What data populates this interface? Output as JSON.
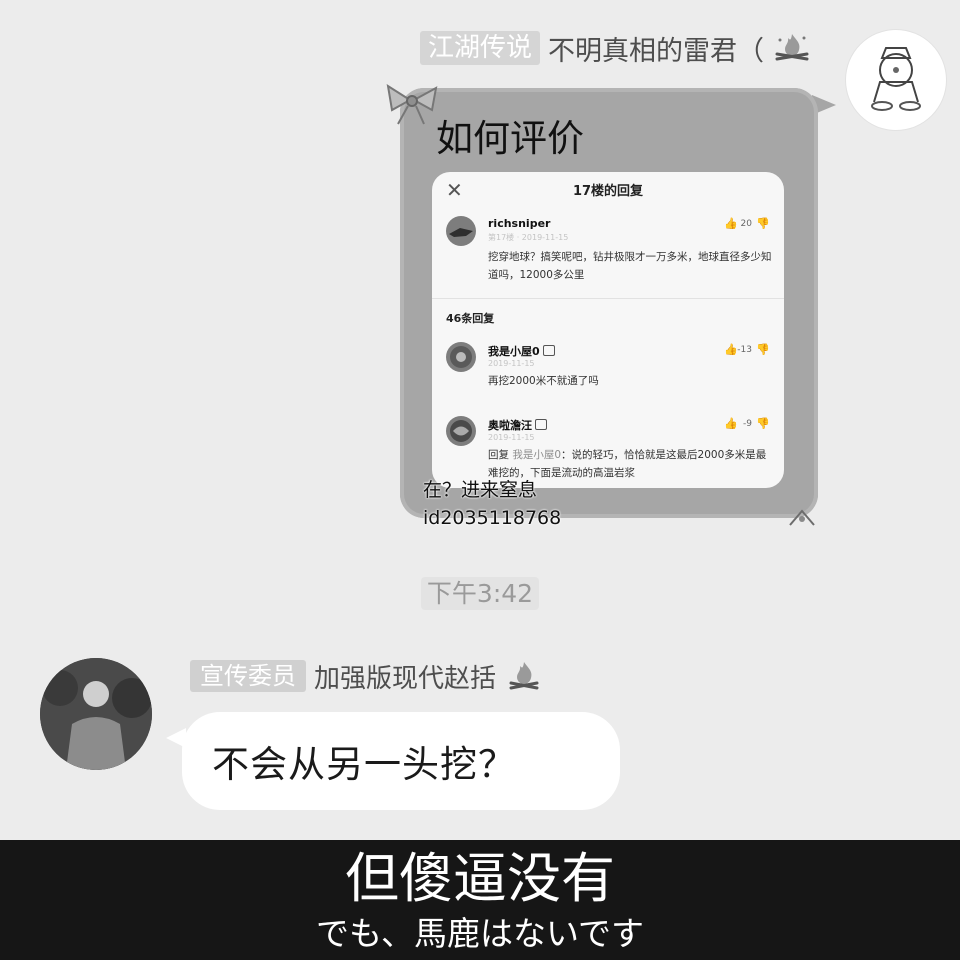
{
  "message1": {
    "title_tag": "江湖传说",
    "nickname": "不明真相的雷君（",
    "bubble_title": "如何评价",
    "flame_icon": "campfire-icon",
    "card": {
      "title": "17楼的回复",
      "close_icon": "close-icon",
      "op": {
        "username": "richsniper",
        "meta": "第17楼 · 2019-11-15",
        "text": "挖穿地球？搞笑呢吧，钻井极限才一万多米，地球直径多少知道吗，12000多公里",
        "likes": "20"
      },
      "reply_count": "46条回复",
      "replies": [
        {
          "username": "我是小屋0",
          "date": "2019-11-15",
          "text": "再挖2000米不就通了吗",
          "likes": "-13"
        },
        {
          "username": "奥啦澹汪",
          "date": "2019-11-15",
          "reply_prefix": "回复 ",
          "reply_target": "我是小屋0",
          "text": "：说的轻巧，恰恰就是这最后2000多米是最难挖的，下面是流动的高温岩浆",
          "likes": "-9"
        }
      ]
    },
    "watermark": {
      "line1": "在？进来窒息",
      "line2": "id2035118768"
    }
  },
  "timestamp": "下午3:42",
  "message2": {
    "title_tag": "宣传委员",
    "nickname": "加强版现代赵括",
    "flame_icon": "campfire-icon",
    "text": "不会从另一头挖？"
  },
  "subtitle": {
    "main": "但傻逼没有",
    "japanese": "でも、馬鹿はないです"
  },
  "colors": {
    "background": "#ececec",
    "bubble_gray": "#a6a6a6",
    "subtitle_bar": "#161616"
  }
}
